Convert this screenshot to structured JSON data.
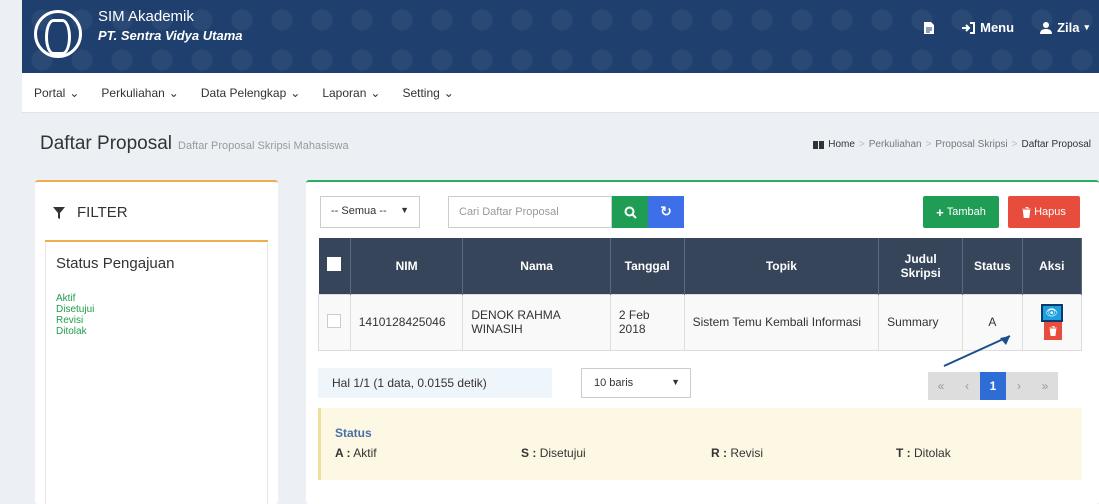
{
  "header": {
    "app_title": "SIM Akademik",
    "app_subtitle": "PT. Sentra Vidya Utama",
    "menu_label": "Menu",
    "user_label": "Zila"
  },
  "menubar": {
    "items": [
      {
        "label": "Portal"
      },
      {
        "label": "Perkuliahan"
      },
      {
        "label": "Data Pelengkap"
      },
      {
        "label": "Laporan"
      },
      {
        "label": "Setting"
      }
    ]
  },
  "page": {
    "title": "Daftar Proposal",
    "subtitle": "Daftar Proposal Skripsi Mahasiswa",
    "breadcrumb": [
      "Home",
      "Perkuliahan",
      "Proposal Skripsi",
      "Daftar Proposal"
    ]
  },
  "filter": {
    "heading": "FILTER",
    "section_title": "Status Pengajuan",
    "options": [
      "Aktif",
      "Disetujui",
      "Revisi",
      "Ditolak"
    ]
  },
  "toolbar": {
    "select_value": "-- Semua --",
    "search_placeholder": "Cari Daftar Proposal",
    "add_label": "Tambah",
    "delete_label": "Hapus"
  },
  "table": {
    "headers": [
      "NIM",
      "Nama",
      "Tanggal",
      "Topik",
      "Judul Skripsi",
      "Status",
      "Aksi"
    ],
    "rows": [
      {
        "nim": "1410128425046",
        "nama": "DENOK RAHMA WINASIH",
        "tanggal": "2 Feb 2018",
        "topik": "Sistem Temu Kembali Informasi",
        "judul": "Summary",
        "status": "A"
      }
    ]
  },
  "pagination": {
    "info": "Hal 1/1 (1 data, 0.0155 detik)",
    "rows_per_page": "10 baris",
    "first": "«",
    "prev": "‹",
    "current": "1",
    "next": "›",
    "last": "»"
  },
  "status_legend": {
    "title": "Status",
    "items": [
      {
        "code": "A :",
        "label": "Aktif"
      },
      {
        "code": "S :",
        "label": "Disetujui"
      },
      {
        "code": "R :",
        "label": "Revisi"
      },
      {
        "code": "T :",
        "label": "Ditolak"
      }
    ]
  },
  "colors": {
    "header_bg": "#1f3f6e",
    "table_header": "#364559",
    "success": "#1f9d55",
    "danger": "#e74c3c",
    "primary": "#2f6dd6",
    "info": "#1ea0e0"
  }
}
